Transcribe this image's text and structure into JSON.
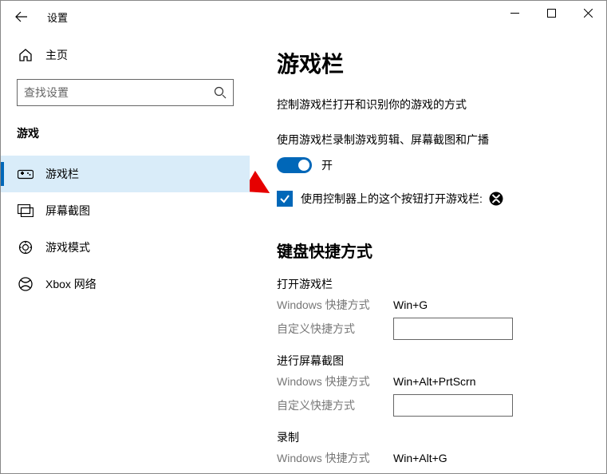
{
  "window": {
    "title": "设置"
  },
  "sidebar": {
    "home_label": "主页",
    "search_placeholder": "查找设置",
    "category": "游戏",
    "items": [
      {
        "label": "游戏栏"
      },
      {
        "label": "屏幕截图"
      },
      {
        "label": "游戏模式"
      },
      {
        "label": "Xbox 网络"
      }
    ]
  },
  "main": {
    "title": "游戏栏",
    "desc": "控制游戏栏打开和识别你的游戏的方式",
    "toggle_desc": "使用游戏栏录制游戏剪辑、屏幕截图和广播",
    "toggle_state": "开",
    "checkbox_label": "使用控制器上的这个按钮打开游戏栏:",
    "shortcut_title": "键盘快捷方式",
    "groups": [
      {
        "title": "打开游戏栏",
        "win_label": "Windows 快捷方式",
        "win_value": "Win+G",
        "custom_label": "自定义快捷方式",
        "custom_value": ""
      },
      {
        "title": "进行屏幕截图",
        "win_label": "Windows 快捷方式",
        "win_value": "Win+Alt+PrtScrn",
        "custom_label": "自定义快捷方式",
        "custom_value": ""
      },
      {
        "title": "录制",
        "win_label": "Windows 快捷方式",
        "win_value": "Win+Alt+G"
      }
    ]
  }
}
